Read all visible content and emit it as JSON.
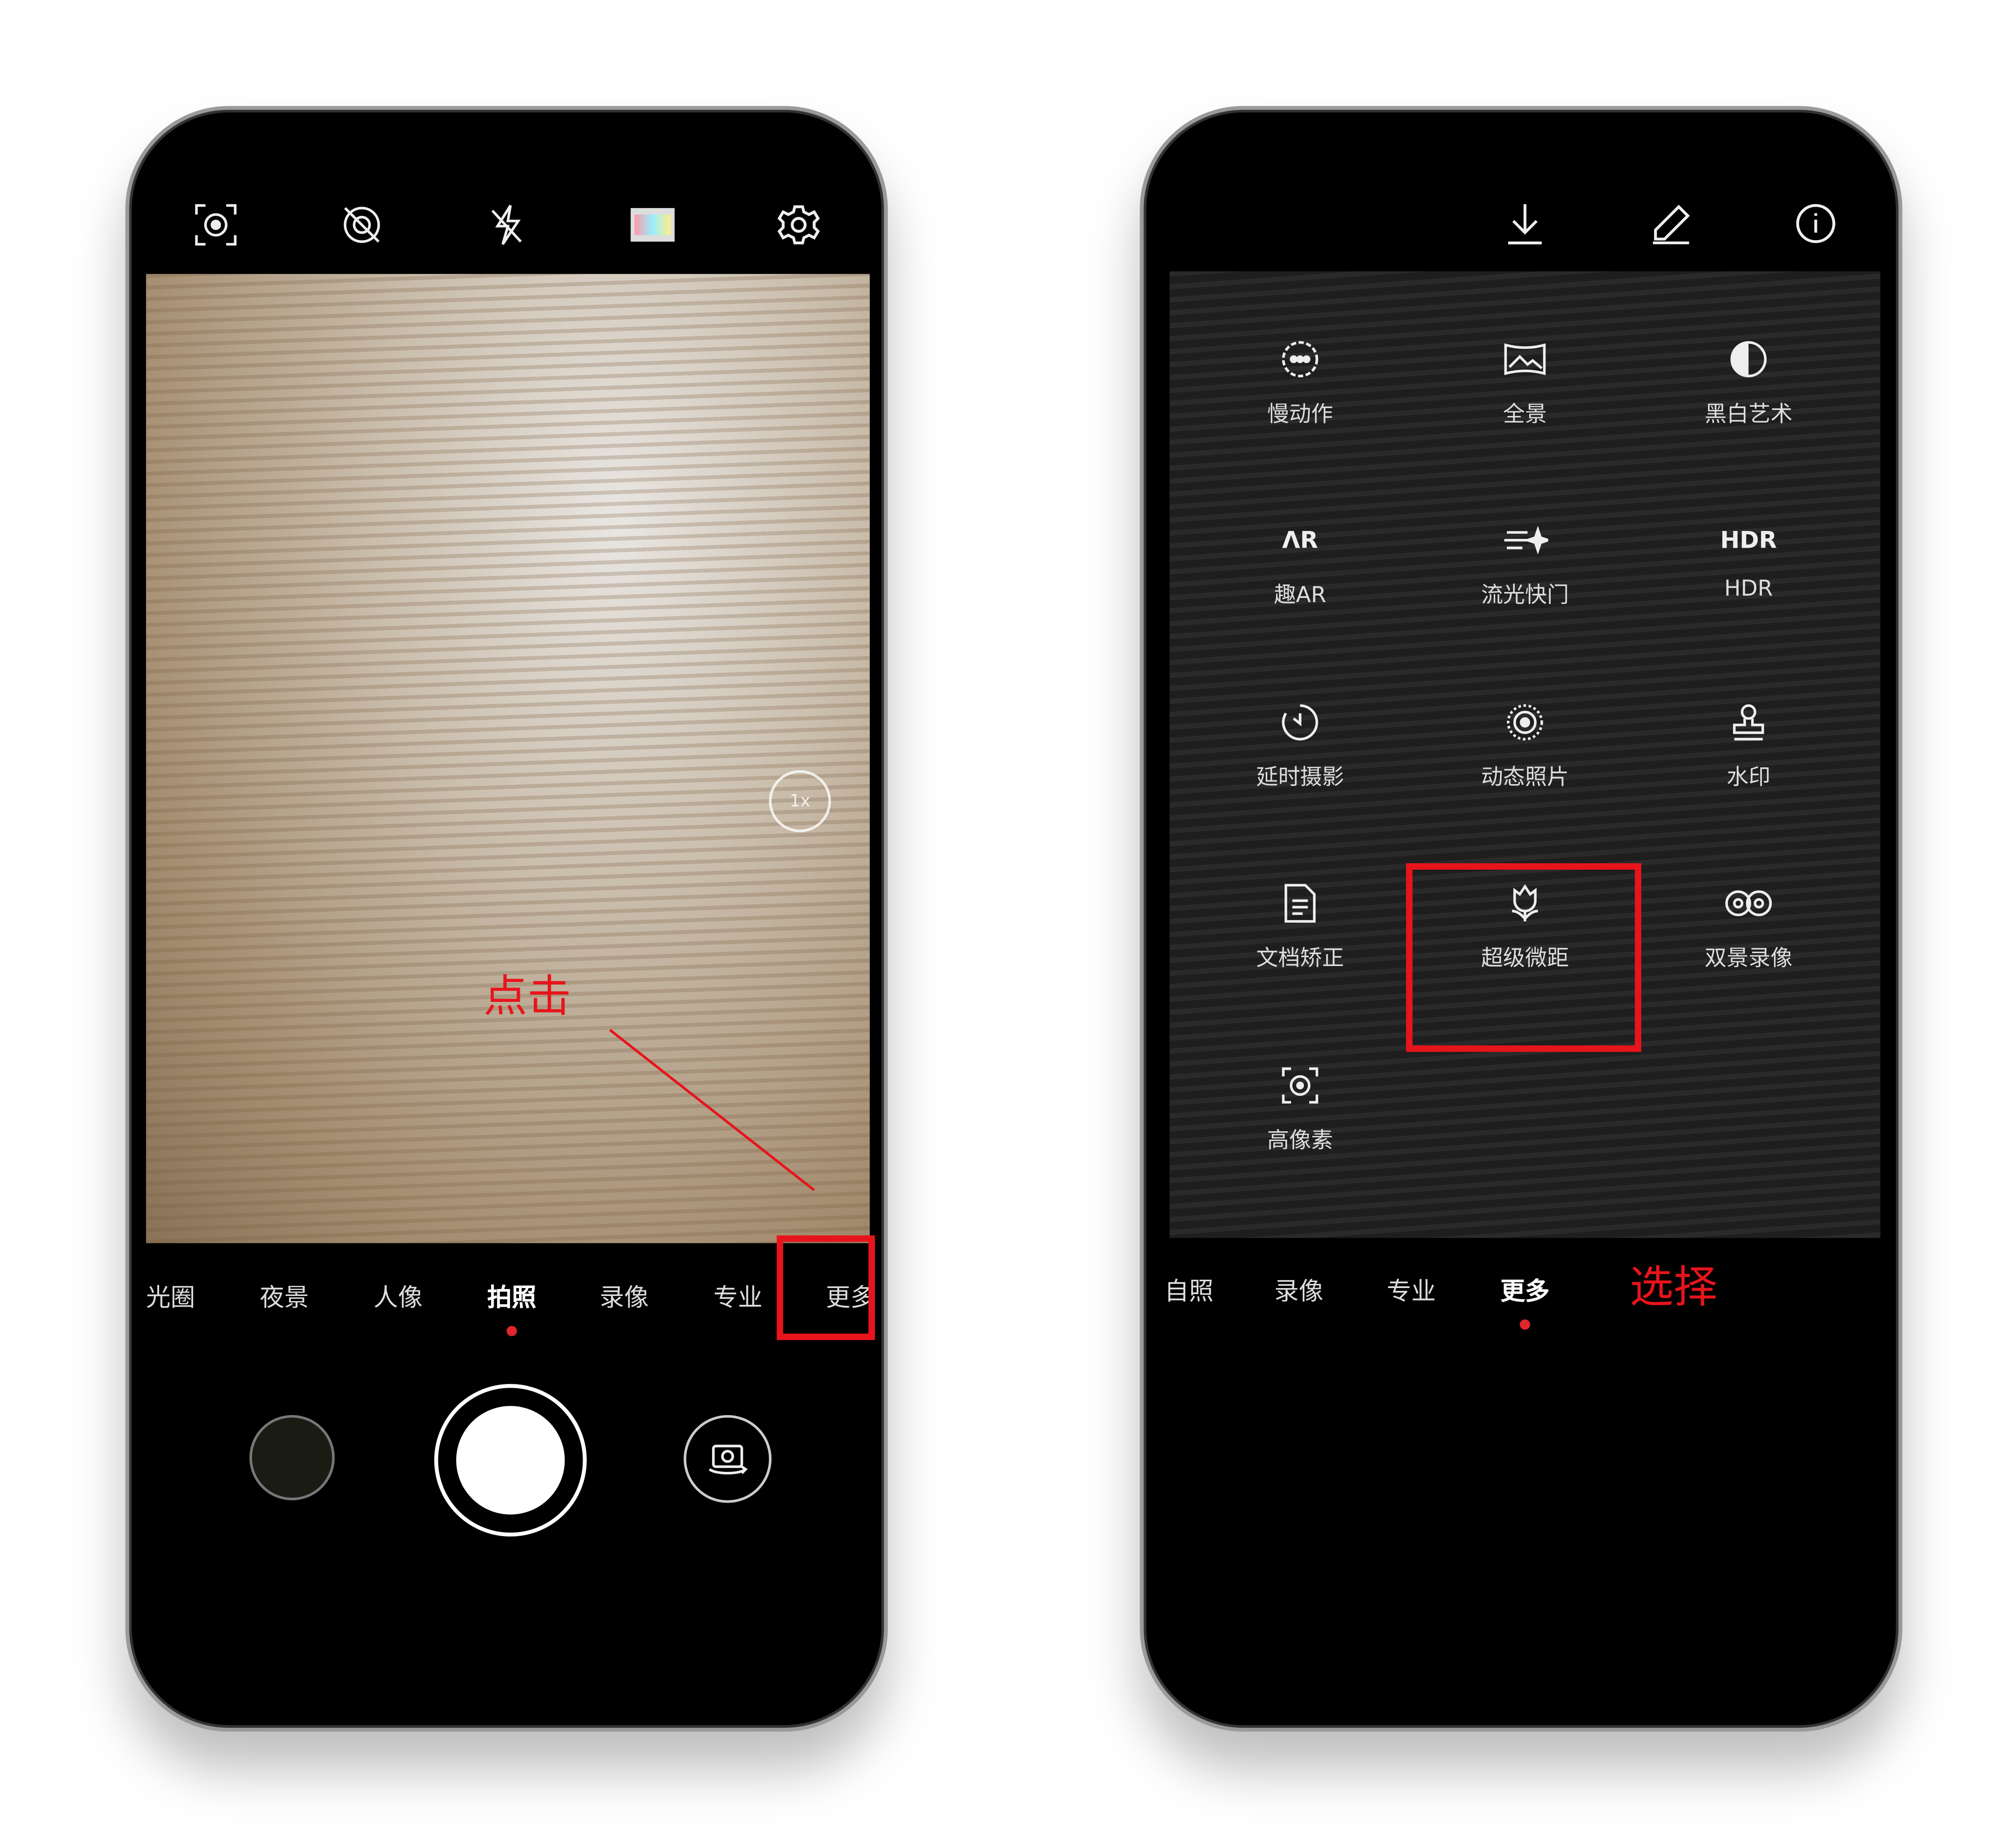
{
  "left_phone": {
    "top_icons": [
      "hdr-icon",
      "aperture-off-icon",
      "flash-off-icon",
      "filter-icon",
      "gear-icon"
    ],
    "zoom_label": "1x",
    "modes": [
      "光圈",
      "夜景",
      "人像",
      "拍照",
      "录像",
      "专业",
      "更多"
    ],
    "active_mode": "拍照",
    "annotation": "点击",
    "annotation_color": "#e8141b"
  },
  "right_phone": {
    "top_icons": [
      "download-icon",
      "edit-icon",
      "info-icon"
    ],
    "grid": [
      {
        "icon": "slow-motion-icon",
        "label": "慢动作"
      },
      {
        "icon": "panorama-icon",
        "label": "全景"
      },
      {
        "icon": "monochrome-icon",
        "label": "黑白艺术"
      },
      {
        "icon": "ar-icon",
        "icon_text": "ΛR",
        "label": "趣AR"
      },
      {
        "icon": "light-painting-icon",
        "label": "流光快门"
      },
      {
        "icon": "hdr-icon",
        "icon_text": "HDR",
        "label": "HDR"
      },
      {
        "icon": "timelapse-icon",
        "label": "延时摄影"
      },
      {
        "icon": "moving-picture-icon",
        "label": "动态照片"
      },
      {
        "icon": "watermark-icon",
        "label": "水印"
      },
      {
        "icon": "document-icon",
        "label": "文档矫正"
      },
      {
        "icon": "macro-flower-icon",
        "label": "超级微距"
      },
      {
        "icon": "dual-view-icon",
        "label": "双景录像"
      },
      {
        "icon": "high-res-icon",
        "label": "高像素"
      }
    ],
    "highlighted": "超级微距",
    "modes": [
      "自照",
      "录像",
      "专业",
      "更多"
    ],
    "active_mode": "更多",
    "annotation": "选择"
  }
}
